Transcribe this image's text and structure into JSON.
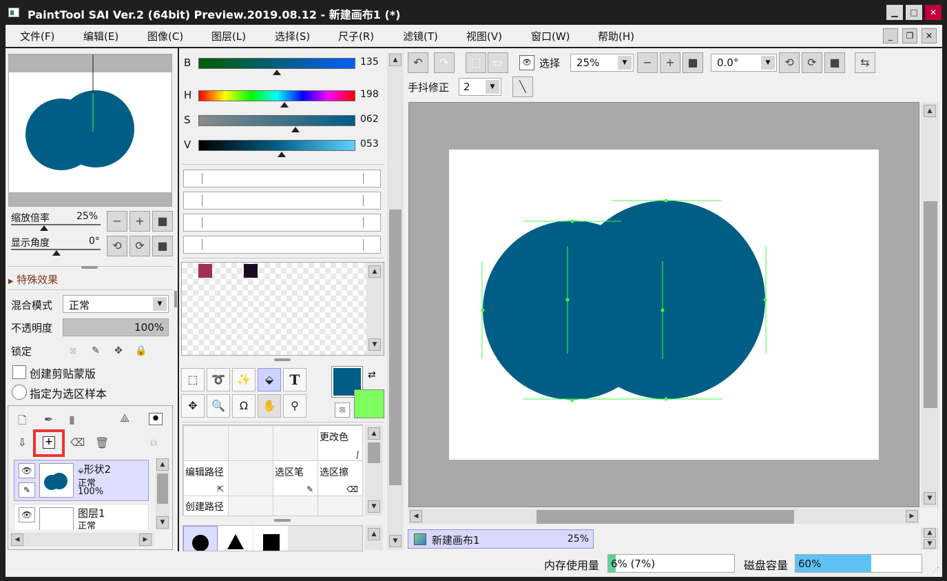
{
  "window": {
    "title": "PaintTool SAI Ver.2 (64bit) Preview.2019.08.12 - 新建画布1 (*)"
  },
  "menu": [
    "文件(F)",
    "编辑(E)",
    "图像(C)",
    "图层(L)",
    "选择(S)",
    "尺子(R)",
    "滤镜(T)",
    "视图(V)",
    "窗口(W)",
    "帮助(H)"
  ],
  "navigator": {
    "zoom_label": "缩放倍率",
    "zoom_value": "25%",
    "angle_label": "显示角度",
    "angle_value": "0°"
  },
  "effects": {
    "label": "特殊效果"
  },
  "layer_props": {
    "blend_label": "混合模式",
    "blend_value": "正常",
    "opacity_label": "不透明度",
    "opacity_value": "100%",
    "opacity_fraction": 1.0,
    "lock_label": "锁定",
    "clip_label": "创建剪贴蒙版",
    "sample_label": "指定为选区样本"
  },
  "layers": [
    {
      "name": "形状2",
      "mode": "正常",
      "opacity": "100%",
      "selected": true
    },
    {
      "name": "图层1",
      "mode": "正常",
      "opacity": "",
      "selected": false
    }
  ],
  "color": {
    "b_label": "B",
    "b_value": "135",
    "b_fraction": 0.5,
    "h_label": "H",
    "h_value": "198",
    "h_fraction": 0.55,
    "s_label": "S",
    "s_value": "062",
    "s_fraction": 0.62,
    "v_label": "V",
    "v_value": "053",
    "v_fraction": 0.53,
    "swatch1": "#a3304f",
    "swatch2": "#1d0a22",
    "primary": "#005e86",
    "secondary": "#7dff5e"
  },
  "tool_grid": {
    "change_color": "更改色",
    "edit_path": "编辑路径",
    "select_pen": "选区笔",
    "select_eraser": "选区擦",
    "create_path": "创建路径"
  },
  "toolbar": {
    "view_label": "选择",
    "zoom": "25%",
    "angle": "0.0°",
    "stabilizer_label": "手抖修正",
    "stabilizer": "2"
  },
  "canvas": {
    "bg": "#ffffff",
    "shape_color": "#005e86",
    "guide_color": "#3cff3c",
    "tab_name": "新建画布1",
    "tab_zoom": "25%"
  },
  "status": {
    "mem_label": "内存使用量",
    "mem_value": "6% (7%)",
    "mem_fraction": 0.06,
    "disk_label": "磁盘容量",
    "disk_value": "60%",
    "disk_fraction": 0.6
  }
}
